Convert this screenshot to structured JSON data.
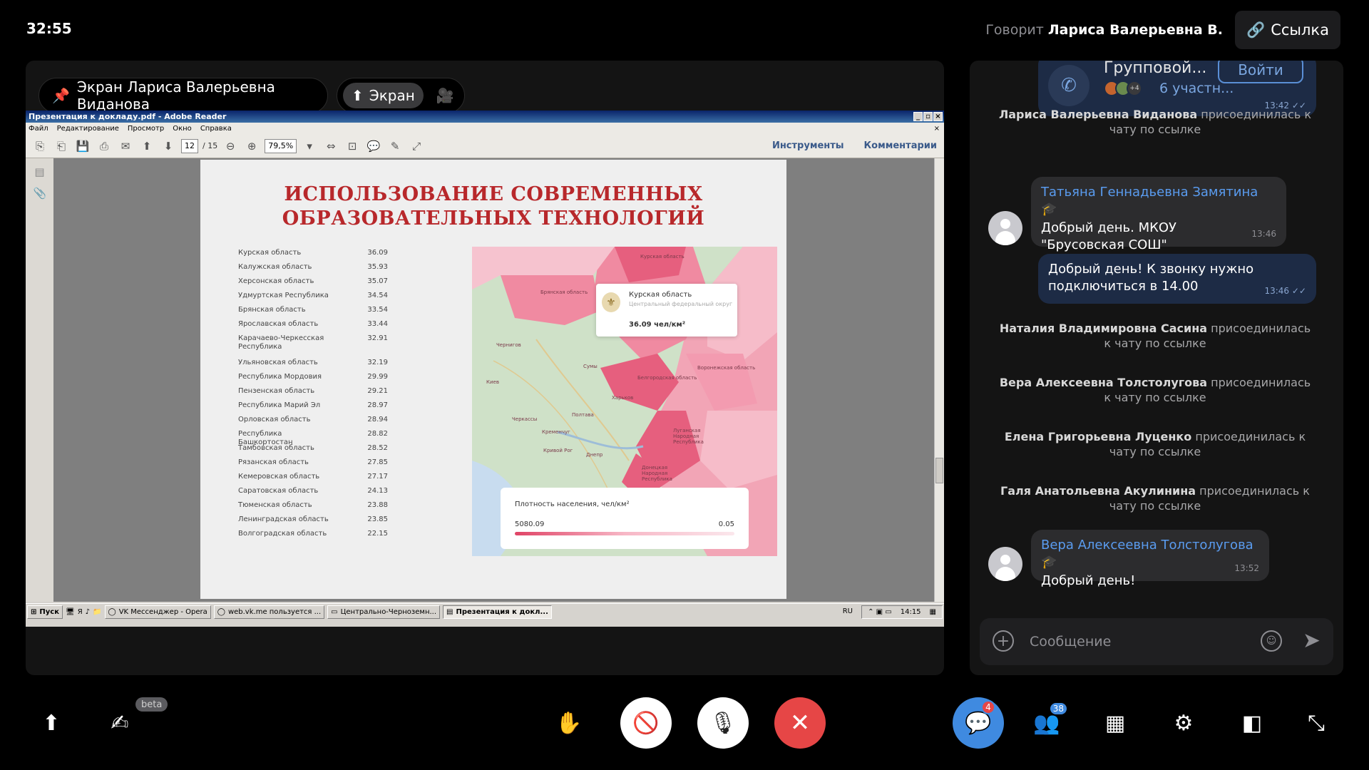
{
  "top": {
    "timer": "32:55",
    "speaker_prefix": "Говорит",
    "speaker_name": "Лариса Валерьевна В.",
    "link_label": "Ссылка"
  },
  "stage": {
    "screen_owner_label": "Экран Лариса Валерьевна Виданова",
    "screen_toggle_label": "Экран"
  },
  "reader": {
    "window_title": "Презентация к докладу.pdf - Adobe Reader",
    "menu": [
      "Файл",
      "Редактирование",
      "Просмотр",
      "Окно",
      "Справка"
    ],
    "page_current": "12",
    "page_total": "/ 15",
    "zoom": "79,5%",
    "tools_label": "Инструменты",
    "comments_label": "Комментарии"
  },
  "slide": {
    "title_line1": "ИСПОЛЬЗОВАНИЕ СОВРЕМЕННЫХ",
    "title_line2": "ОБРАЗОВАТЕЛЬНЫХ ТЕХНОЛОГИЙ",
    "ranking": [
      {
        "name": "Курская область",
        "value": "36.09"
      },
      {
        "name": "Калужская область",
        "value": "35.93"
      },
      {
        "name": "Херсонская область",
        "value": "35.07"
      },
      {
        "name": "Удмуртская Республика",
        "value": "34.54"
      },
      {
        "name": "Брянская область",
        "value": "33.54"
      },
      {
        "name": "Ярославская область",
        "value": "33.44"
      },
      {
        "name": "Карачаево-Черкесская Республика",
        "value": "32.91"
      },
      {
        "name": "Ульяновская область",
        "value": "32.19"
      },
      {
        "name": "Республика Мордовия",
        "value": "29.99"
      },
      {
        "name": "Пензенская область",
        "value": "29.21"
      },
      {
        "name": "Республика Марий Эл",
        "value": "28.97"
      },
      {
        "name": "Орловская область",
        "value": "28.94"
      },
      {
        "name": "Республика Башкортостан",
        "value": "28.82"
      },
      {
        "name": "Тамбовская область",
        "value": "28.52"
      },
      {
        "name": "Рязанская область",
        "value": "27.85"
      },
      {
        "name": "Кемеровская область",
        "value": "27.17"
      },
      {
        "name": "Саратовская область",
        "value": "24.13"
      },
      {
        "name": "Тюменская область",
        "value": "23.88"
      },
      {
        "name": "Ленинградская область",
        "value": "23.85"
      },
      {
        "name": "Волгоградская область",
        "value": "22.15"
      }
    ],
    "tooltip_region": "Курская область",
    "tooltip_district": "Центральный федеральный округ",
    "tooltip_value": "36.09 чел/км²",
    "legend_title": "Плотность населения, чел/км²",
    "legend_max": "5080.09",
    "legend_min": "0.05",
    "map_labels": [
      "Курская область",
      "Брянская область",
      "Белгородская область",
      "Воронежская область",
      "Харьков",
      "Сумы",
      "Полтава",
      "Днепр",
      "Кривой Рог",
      "Киев",
      "Чернигов",
      "Черкассы",
      "Кременчуг",
      "Донецкая Народная Республика",
      "Луганская Народная Республика"
    ]
  },
  "taskbar": {
    "start": "Пуск",
    "items": [
      "VK Мессенджер - Opera",
      "web.vk.me пользуется ...",
      "Центрально-Черноземн...",
      "Презентация к докл..."
    ],
    "lang": "RU",
    "clock": "14:15"
  },
  "chat": {
    "call_card": {
      "name": "Групповой...",
      "participants_extra": "+4",
      "participants": "6 участн...",
      "join_label": "Войти",
      "time": "13:42"
    },
    "sys_suffix": "присоединилась к чату по ссылке",
    "system_1": "Лариса Валерьевна Виданова",
    "msg_1": {
      "author": "Татьяна Геннадьевна Замятина",
      "text": "Добрый день. МКОУ \"Брусовская СОШ\" Поныровского района",
      "time": "13:46"
    },
    "msg_2": {
      "text": "Добрый день! К звонку нужно подключиться в 14.00",
      "time": "13:46"
    },
    "system_2": "Наталия Владимировна Сасина",
    "system_3": "Вера Алексеевна Толстолугова",
    "system_4": "Елена Григорьевна Луценко",
    "system_5": "Галя Анатольевна Акулинина",
    "msg_3": {
      "author": "Вера Алексеевна Толстолугова",
      "text": "Добрый день!",
      "time": "13:52"
    },
    "composer_placeholder": "Сообщение"
  },
  "controls": {
    "beta_label": "beta",
    "chat_badge": "4",
    "participants_badge": "38"
  },
  "colors": {
    "accent_blue": "#3f8ae0",
    "end_call_red": "#e64646",
    "slide_title_red": "#b8282b"
  }
}
